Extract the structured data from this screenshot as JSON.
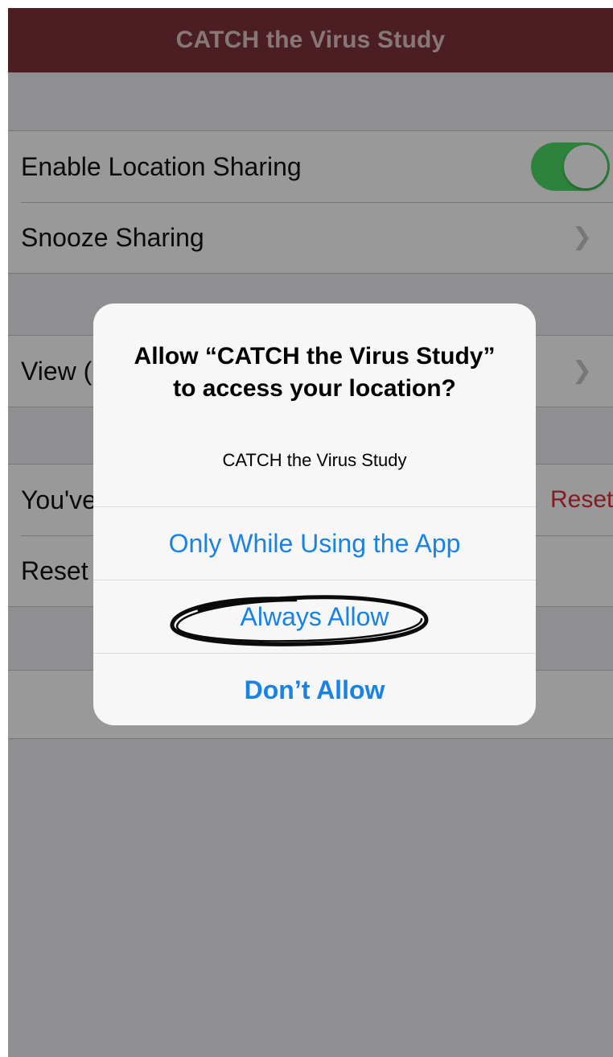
{
  "app": {
    "title": "CATCH the Virus Study"
  },
  "settings": {
    "location_sharing": {
      "label": "Enable Location Sharing",
      "enabled": true
    },
    "snooze": {
      "label": "Snooze Sharing"
    },
    "view_row": {
      "label": "View ("
    },
    "youve_row": {
      "label": "You've",
      "action": "Reset"
    },
    "reset_row": {
      "label": "Reset"
    }
  },
  "alert": {
    "title": "Allow “CATCH the Virus Study” to access your location?",
    "message": "CATCH the Virus Study",
    "buttons": {
      "while_using": "Only While Using the App",
      "always": "Always Allow",
      "dont": "Don’t Allow"
    }
  },
  "colors": {
    "navbar": "#7c3239",
    "toggle_on": "#4cd964",
    "ios_blue": "#1a82e2",
    "destructive": "#d9303b"
  }
}
